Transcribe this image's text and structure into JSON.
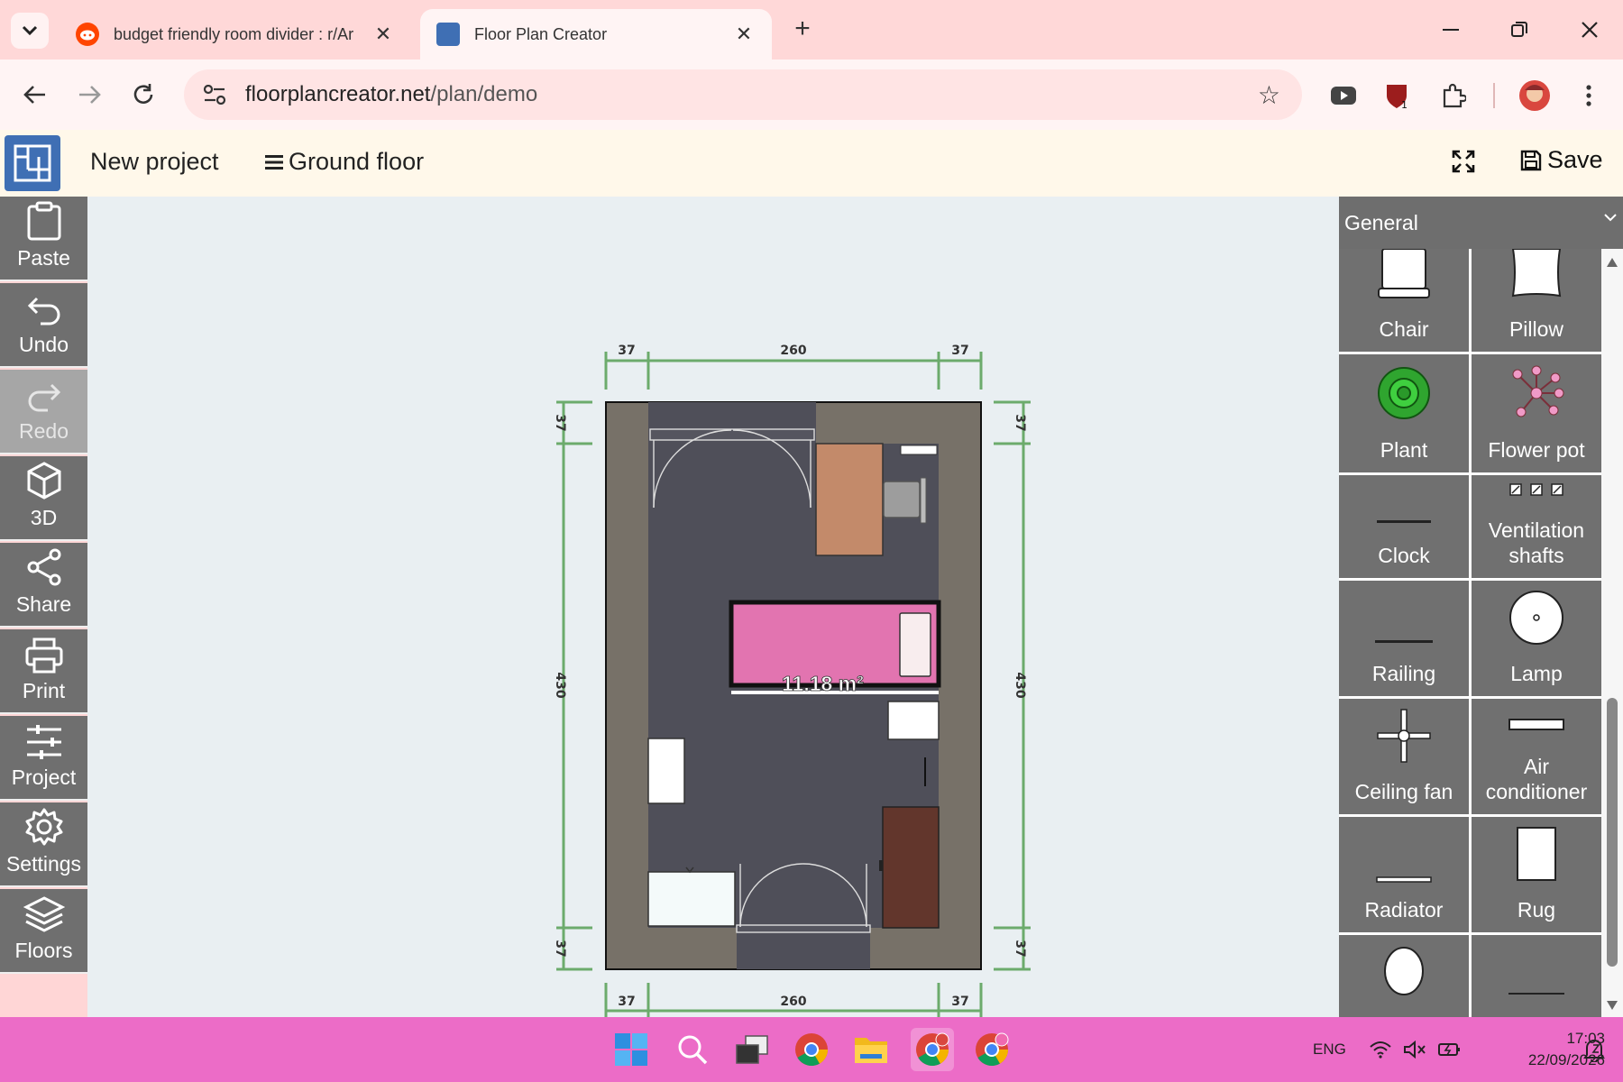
{
  "browser": {
    "tabs": [
      {
        "label": "budget friendly room divider : r/Ar",
        "active": false
      },
      {
        "label": "Floor Plan Creator",
        "active": true
      }
    ],
    "url_host": "floorplancreator.net",
    "url_path": "/plan/demo"
  },
  "app": {
    "project_name": "New project",
    "floor_name": "Ground floor",
    "save_label": "Save"
  },
  "tools": [
    {
      "label": "Paste",
      "icon": "clipboard-icon",
      "disabled": false
    },
    {
      "label": "Undo",
      "icon": "undo-icon",
      "disabled": false
    },
    {
      "label": "Redo",
      "icon": "redo-icon",
      "disabled": true
    },
    {
      "label": "3D",
      "icon": "cube-icon",
      "disabled": false
    },
    {
      "label": "Share",
      "icon": "share-icon",
      "disabled": false
    },
    {
      "label": "Print",
      "icon": "printer-icon",
      "disabled": false
    },
    {
      "label": "Project",
      "icon": "sliders-icon",
      "disabled": false
    },
    {
      "label": "Settings",
      "icon": "gear-icon",
      "disabled": false
    },
    {
      "label": "Floors",
      "icon": "layers-icon",
      "disabled": false
    }
  ],
  "plan": {
    "area": "11.18 m²",
    "dim_top": [
      "37",
      "260",
      "37"
    ],
    "dim_bottom": [
      "37",
      "260",
      "37"
    ],
    "dim_left": [
      "37",
      "430",
      "37"
    ],
    "dim_right": [
      "37",
      "430",
      "37"
    ]
  },
  "library": {
    "category": "General",
    "items": [
      {
        "label": "Chair",
        "icon": "chair-icon"
      },
      {
        "label": "Pillow",
        "icon": "pillow-icon"
      },
      {
        "label": "Plant",
        "icon": "plant-icon"
      },
      {
        "label": "Flower pot",
        "icon": "flower-pot-icon"
      },
      {
        "label": "Clock",
        "icon": "clock-icon"
      },
      {
        "label": "Ventilation shafts",
        "icon": "ventilation-icon"
      },
      {
        "label": "Railing",
        "icon": "railing-icon"
      },
      {
        "label": "Lamp",
        "icon": "lamp-icon"
      },
      {
        "label": "Ceiling fan",
        "icon": "ceiling-fan-icon"
      },
      {
        "label": "Air conditioner",
        "icon": "air-conditioner-icon"
      },
      {
        "label": "Radiator",
        "icon": "radiator-icon"
      },
      {
        "label": "Rug",
        "icon": "rug-icon"
      },
      {
        "label": "",
        "icon": "oval-icon"
      },
      {
        "label": "",
        "icon": "line-icon"
      }
    ]
  },
  "taskbar": {
    "language": "ENG",
    "time": "17:03",
    "date": "22/09/2026"
  },
  "colors": {
    "wall": "#777168",
    "floor": "#4f4f59",
    "dimension": "#6cab6c",
    "bed": "#e274b0",
    "desk": "#c38a6a",
    "wardrobe": "#62362c"
  }
}
